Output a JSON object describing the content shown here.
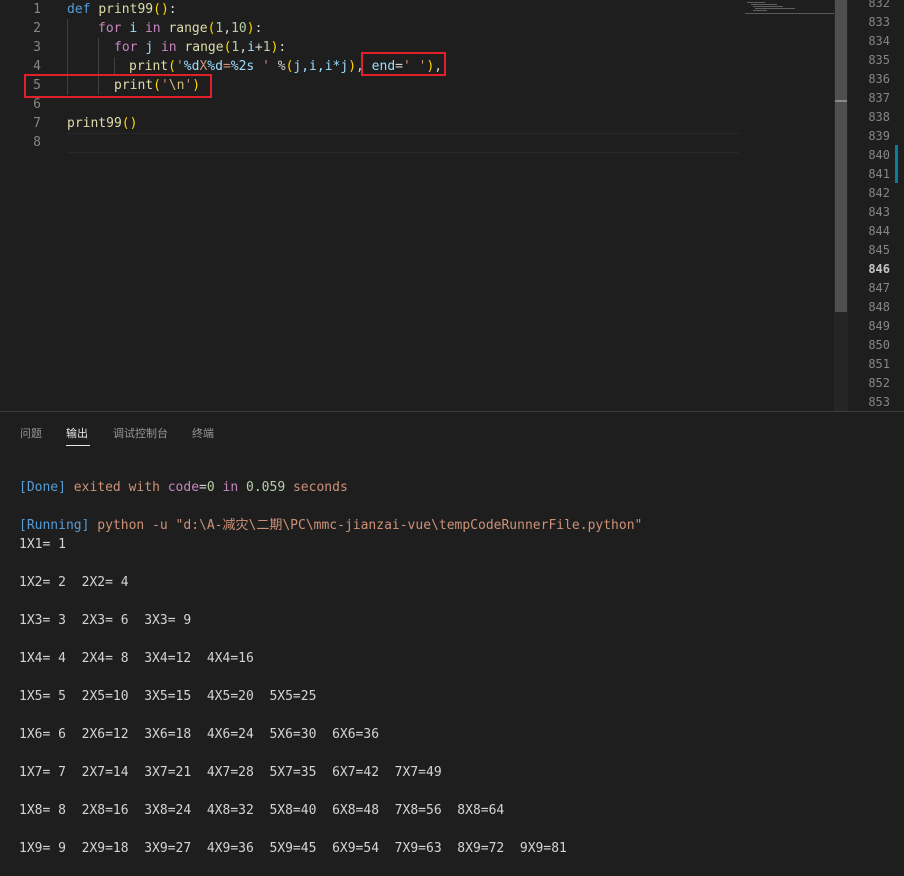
{
  "editor": {
    "line_numbers": [
      "1",
      "2",
      "3",
      "4",
      "5",
      "6",
      "7",
      "8"
    ],
    "code": {
      "l1": {
        "kw": "def",
        "fn": "print99",
        "p1": "(",
        "p2": ")",
        "colon": ":"
      },
      "l2": {
        "kw": "for",
        "var": "i",
        "in": "in",
        "fn": "range",
        "p1": "(",
        "n1": "1",
        "comma": ",",
        "n2": "10",
        "p2": ")",
        "colon": ":"
      },
      "l3": {
        "kw": "for",
        "var": "j",
        "in": "in",
        "fn": "range",
        "p1": "(",
        "n1": "1",
        "comma": ",",
        "var2": "i",
        "plus": "+",
        "n2": "1",
        "p2": ")",
        "colon": ":"
      },
      "l4": {
        "fn": "print",
        "p1": "(",
        "str1": "'",
        "fmt1": "%d",
        "mid": "X",
        "fmt2": "%d",
        "eq": "=",
        "fmt3": "%2s",
        "str2": " '",
        "pct": " %",
        "p3": "(",
        "args": "j,i,i*j",
        "p4": ")",
        "comma": ", ",
        "kwarg": "end",
        "eq2": "=",
        "str3": "' '",
        "p2": ")",
        "comma2": ","
      },
      "l5": {
        "fn": "print",
        "p1": "(",
        "str1": "'",
        "esc": "\\n",
        "str2": "'",
        "p2": ")"
      },
      "l7": {
        "fn": "print99",
        "p1": "(",
        "p2": ")"
      }
    },
    "right_line_numbers": [
      "832",
      "833",
      "834",
      "835",
      "836",
      "837",
      "838",
      "839",
      "840",
      "841",
      "842",
      "843",
      "844",
      "845",
      "846",
      "847",
      "848",
      "849",
      "850",
      "851",
      "852",
      "853"
    ],
    "active_right_line": "846"
  },
  "panel": {
    "tabs": [
      {
        "label": "问题"
      },
      {
        "label": "输出"
      },
      {
        "label": "调试控制台"
      },
      {
        "label": "终端"
      }
    ],
    "active_tab": "输出",
    "done_line": {
      "tag": "[Done]",
      "exited": " exited",
      "with": " with",
      "code_kw": " code",
      "eq": "=",
      "code_val": "0",
      "in": " in",
      "secs": " 0.059",
      "seconds": " seconds"
    },
    "running_line": {
      "tag": "[Running]",
      "cmd": " python -u ",
      "path": "\"d:\\A-减灾\\二期\\PC\\mmc-jianzai-vue\\tempCodeRunnerFile.python\""
    },
    "output_rows": [
      "1X1= 1",
      "1X2= 2  2X2= 4",
      "1X3= 3  2X3= 6  3X3= 9",
      "1X4= 4  2X4= 8  3X4=12  4X4=16",
      "1X5= 5  2X5=10  3X5=15  4X5=20  5X5=25",
      "1X6= 6  2X6=12  3X6=18  4X6=24  5X6=30  6X6=36",
      "1X7= 7  2X7=14  3X7=21  4X7=28  5X7=35  6X7=42  7X7=49",
      "1X8= 8  2X8=16  3X8=24  4X8=32  5X8=40  6X8=48  7X8=56  8X8=64",
      "1X9= 9  2X9=18  3X9=27  4X9=36  5X9=45  6X9=54  7X9=63  8X9=72  9X9=81"
    ]
  },
  "colors": {
    "highlight_box": "#e0212b",
    "background": "#1e1e1e",
    "keyword": "#569cd6",
    "function": "#dcdcaa",
    "string": "#ce9178"
  }
}
